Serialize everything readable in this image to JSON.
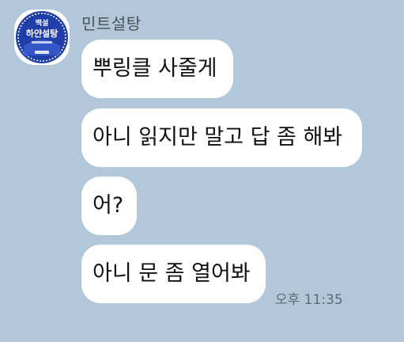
{
  "chat": {
    "sender_name": "민트설탕",
    "avatar": {
      "icon": "sugar-package-icon",
      "brand_text": "백설",
      "product_text": "하얀설탕",
      "colors": {
        "blue": "#1f3ea8",
        "white": "#ffffff"
      }
    },
    "messages": [
      {
        "text": "뿌링클 사줄게"
      },
      {
        "text": "아니 읽지만 말고 답 좀 해봐"
      },
      {
        "text": "어?"
      },
      {
        "text": "아니 문 좀 열어봐"
      }
    ],
    "timestamp": "오후 11:35"
  },
  "theme": {
    "background": "#b2c7d9",
    "bubble": "#ffffff"
  }
}
